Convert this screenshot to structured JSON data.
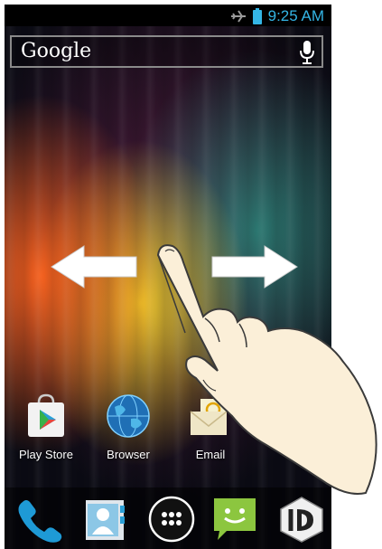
{
  "status_bar": {
    "time": "9:25 AM",
    "icons": [
      "airplane-mode-icon",
      "battery-icon"
    ],
    "accent_color": "#34b5e5"
  },
  "search_widget": {
    "brand": "Google",
    "icons": [
      "mic-icon"
    ]
  },
  "gesture": {
    "icons": [
      "left-arrow-icon",
      "right-arrow-icon",
      "swiping-hand-icon"
    ]
  },
  "home_apps": [
    {
      "label": "Play Store",
      "icon": "play-store-icon"
    },
    {
      "label": "Browser",
      "icon": "browser-globe-icon"
    },
    {
      "label": "Email",
      "icon": "email-icon"
    }
  ],
  "dock": {
    "items": [
      "phone-icon",
      "contacts-icon",
      "app-drawer-icon",
      "messaging-icon",
      "3d-app-icon"
    ]
  }
}
